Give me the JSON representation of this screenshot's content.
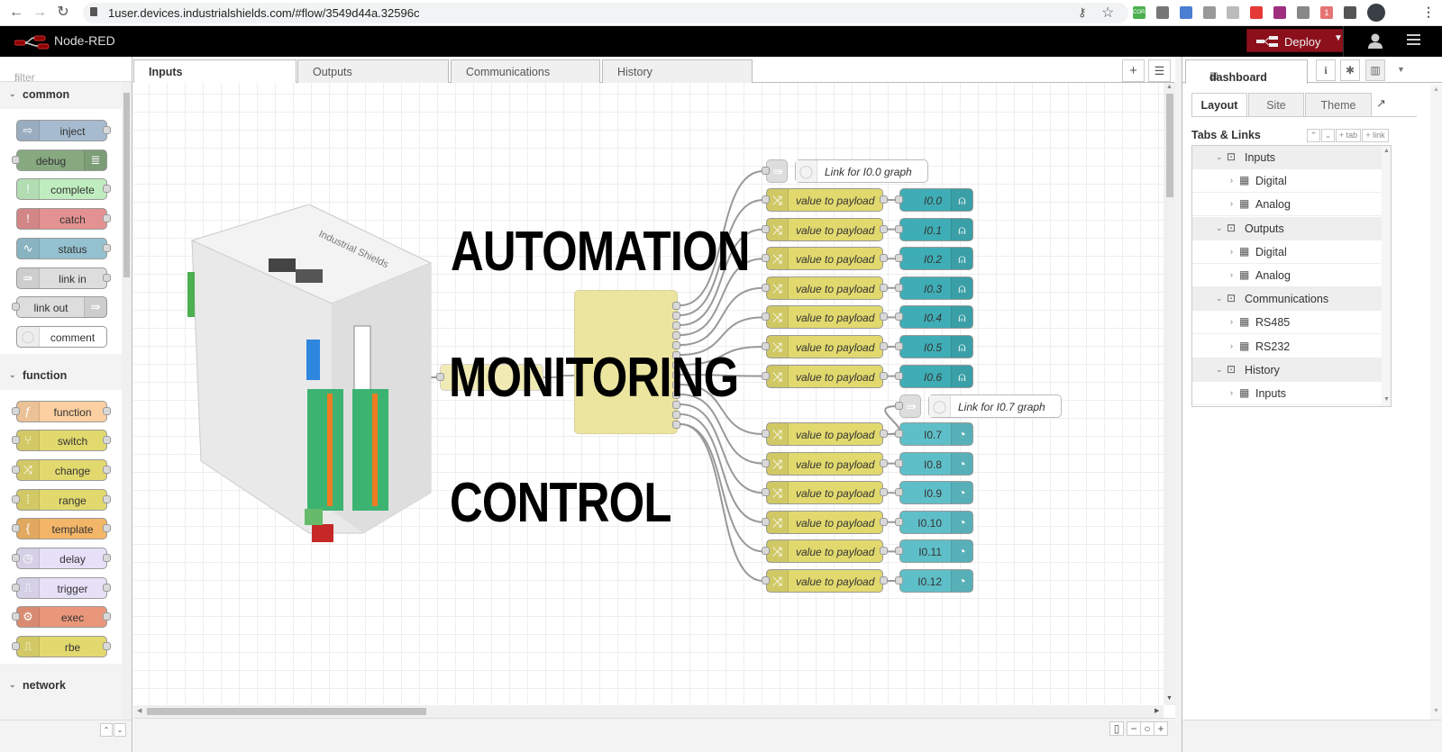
{
  "browser": {
    "url": "1user.devices.industrialshields.com/#flow/3549d44a.32596c",
    "extensions": [
      {
        "name": "cors-extension-icon",
        "label": "CORS",
        "color": "#4caf50"
      },
      {
        "name": "extension-icon-2",
        "label": "",
        "color": "#777"
      },
      {
        "name": "extension-icon-3",
        "label": "",
        "color": "#4a7fd4"
      },
      {
        "name": "extension-icon-4",
        "label": "",
        "color": "#999"
      },
      {
        "name": "extension-icon-5",
        "label": "",
        "color": "#bbb"
      },
      {
        "name": "extension-icon-6",
        "label": "",
        "color": "#e53935"
      },
      {
        "name": "extension-icon-7",
        "label": "",
        "color": "#a0307f"
      },
      {
        "name": "extension-icon-8",
        "label": "",
        "color": "#888"
      },
      {
        "name": "extension-icon-9",
        "label": "1",
        "color": "#e57373"
      },
      {
        "name": "puzzle-icon",
        "label": "",
        "color": "#555"
      }
    ]
  },
  "header": {
    "app_title": "Node-RED",
    "deploy_label": "Deploy"
  },
  "palette": {
    "filter_placeholder": "filter nodes",
    "categories": [
      {
        "name": "common",
        "nodes": [
          {
            "label": "inject",
            "color": "#a6bbcf",
            "icon": "⇨",
            "icon_side": "left",
            "in": false,
            "out": true
          },
          {
            "label": "debug",
            "color": "#87a980",
            "icon": "≣",
            "icon_side": "right",
            "in": true,
            "out": false
          },
          {
            "label": "complete",
            "color": "#c0edc0",
            "icon": "!",
            "icon_side": "left",
            "in": false,
            "out": true
          },
          {
            "label": "catch",
            "color": "#e49191",
            "icon": "!",
            "icon_side": "left",
            "in": false,
            "out": true
          },
          {
            "label": "status",
            "color": "#94c1d0",
            "icon": "∿",
            "icon_side": "left",
            "in": false,
            "out": true
          },
          {
            "label": "link in",
            "color": "#dddddd",
            "icon": "⇛",
            "icon_side": "left",
            "in": false,
            "out": true
          },
          {
            "label": "link out",
            "color": "#dddddd",
            "icon": "⇛",
            "icon_side": "right",
            "in": true,
            "out": false
          },
          {
            "label": "comment",
            "color": "#ffffff",
            "icon": "◯",
            "icon_side": "left",
            "in": false,
            "out": false
          }
        ]
      },
      {
        "name": "function",
        "nodes": [
          {
            "label": "function",
            "color": "#fdd0a2",
            "icon": "ƒ",
            "icon_side": "left",
            "in": true,
            "out": true
          },
          {
            "label": "switch",
            "color": "#e2d96e",
            "icon": "⑂",
            "icon_side": "left",
            "in": true,
            "out": true
          },
          {
            "label": "change",
            "color": "#e2d96e",
            "icon": "⤨",
            "icon_side": "left",
            "in": true,
            "out": true
          },
          {
            "label": "range",
            "color": "#e2d96e",
            "icon": "⁞",
            "icon_side": "left",
            "in": true,
            "out": true
          },
          {
            "label": "template",
            "color": "#f3b567",
            "icon": "{",
            "icon_side": "left",
            "in": true,
            "out": true
          },
          {
            "label": "delay",
            "color": "#e6e0f8",
            "icon": "◷",
            "icon_side": "left",
            "in": true,
            "out": true
          },
          {
            "label": "trigger",
            "color": "#e6e0f8",
            "icon": "⎍",
            "icon_side": "left",
            "in": true,
            "out": true
          },
          {
            "label": "exec",
            "color": "#e9967a",
            "icon": "⚙",
            "icon_side": "left",
            "in": true,
            "out": true
          },
          {
            "label": "rbe",
            "color": "#e2d96e",
            "icon": "⎍",
            "icon_side": "left",
            "in": true,
            "out": true
          }
        ]
      },
      {
        "name": "network",
        "nodes": []
      }
    ]
  },
  "workspace": {
    "tabs": [
      {
        "label": "Inputs",
        "active": true
      },
      {
        "label": "Outputs",
        "active": false
      },
      {
        "label": "Communications",
        "active": false
      },
      {
        "label": "History",
        "active": false
      }
    ],
    "overlay_text": [
      "AUTOMATION",
      "MONITORING",
      "CONTROL"
    ],
    "device_brand": "Industrial Shields",
    "link_comments": [
      "Link for I0.0 graph",
      "Link for I0.7 graph"
    ],
    "change_node_label": "value to payload",
    "digital_inputs": [
      "I0.0",
      "I0.1",
      "I0.2",
      "I0.3",
      "I0.4",
      "I0.5",
      "I0.6"
    ],
    "analog_inputs": [
      "I0.7",
      "I0.8",
      "I0.9",
      "I0.10",
      "I0.11",
      "I0.12"
    ]
  },
  "sidebar": {
    "active_tab_label": "dashboard",
    "dashboard_tabs": [
      {
        "label": "Layout",
        "active": true
      },
      {
        "label": "Site",
        "active": false
      },
      {
        "label": "Theme",
        "active": false
      }
    ],
    "section_title": "Tabs & Links",
    "add_tab_label": "+ tab",
    "add_link_label": "+ link",
    "tree": [
      {
        "label": "Inputs",
        "type": "tab",
        "children": [
          "Digital",
          "Analog"
        ]
      },
      {
        "label": "Outputs",
        "type": "tab",
        "children": [
          "Digital",
          "Analog"
        ]
      },
      {
        "label": "Communications",
        "type": "tab",
        "children": [
          "RS485",
          "RS232"
        ]
      },
      {
        "label": "History",
        "type": "tab",
        "children": [
          "Inputs"
        ]
      }
    ]
  }
}
